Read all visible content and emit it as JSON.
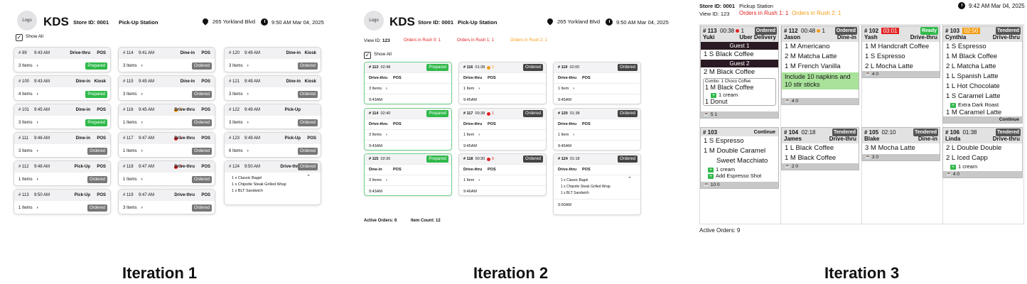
{
  "iter1": {
    "logo": "Logo",
    "app": "KDS",
    "store": "Store ID: 0001",
    "station": "Pick-Up Station",
    "address": "265 Yorkland Blvd",
    "datetime": "9:50 AM Mar 04, 2025",
    "show_all": "Show All",
    "cards": [
      {
        "num": "# 99",
        "time": "9:43 AM",
        "type": "Drive-thru",
        "src": "POS",
        "items": "3 Items",
        "status": "Prepared"
      },
      {
        "num": "# 100",
        "time": "9:43 AM",
        "type": "Dine-in",
        "src": "Kiosk",
        "items": "4 Items",
        "status": "Prepared"
      },
      {
        "num": "# 101",
        "time": "9:45 AM",
        "type": "Dine-in",
        "src": "POS",
        "items": "3 Items",
        "status": "Prepared"
      },
      {
        "num": "# 111",
        "time": "9:46 AM",
        "type": "Dine-in",
        "src": "POS",
        "items": "3 Items",
        "status": "Ordered"
      },
      {
        "num": "# 112",
        "time": "9:48 AM",
        "type": "Pick-Up",
        "src": "POS",
        "items": "1 Items",
        "status": "Ordered"
      },
      {
        "num": "# 113",
        "time": "9:50 AM",
        "type": "Pick-Up",
        "src": "POS",
        "items": "1 Items",
        "status": "Ordered"
      },
      {
        "num": "# 114",
        "time": "9:41 AM",
        "type": "Dine-in",
        "src": "POS",
        "items": "3 Items",
        "status": "Ordered"
      },
      {
        "num": "# 115",
        "time": "9:45 AM",
        "type": "Dine-in",
        "src": "POS",
        "items": "3 Items",
        "status": "Ordered"
      },
      {
        "num": "# 116",
        "time": "9:45 AM",
        "dot": "2",
        "type": "Drive-thru",
        "src": "POS",
        "items": "1 Items",
        "status": "Ordered"
      },
      {
        "num": "# 117",
        "time": "9:47 AM",
        "dot": "1",
        "type": "Drive-thru",
        "src": "POS",
        "items": "1 Items",
        "status": "Ordered"
      },
      {
        "num": "# 118",
        "time": "9:47 AM",
        "dot": "0",
        "type": "Drive-thru",
        "src": "POS",
        "items": "1 Items",
        "status": "Ordered"
      },
      {
        "num": "# 119",
        "time": "9:47 AM",
        "type": "Drive-thru",
        "src": "POS",
        "items": "3 Items",
        "status": "Ordered"
      },
      {
        "num": "# 120",
        "time": "9:49 AM",
        "type": "Dine-in",
        "src": "Kiosk",
        "items": "3 Items",
        "status": "Ordered"
      },
      {
        "num": "# 121",
        "time": "9:49 AM",
        "type": "Dine-in",
        "src": "Kiosk",
        "items": "3 Items",
        "status": "Ordered"
      },
      {
        "num": "# 122",
        "time": "9:49 AM",
        "type": "Pick-Up",
        "src": "",
        "items": "3 Items",
        "status": "Ordered"
      },
      {
        "num": "# 123",
        "time": "9:49 AM",
        "type": "Pick-Up",
        "src": "POS",
        "items": "6 Items",
        "status": "Ordered"
      }
    ],
    "expanded": {
      "num": "# 124",
      "time": "9:50 AM",
      "type": "Drive-thru",
      "src": "POS",
      "status": "Ordered",
      "lines": [
        "1 x  Classic Bagel",
        "1 x  Chipotle Steak Grilled Wrap",
        "1 x  BLT Sandwich"
      ]
    }
  },
  "iter2": {
    "logo": "Logo",
    "app": "KDS",
    "store": "Store ID: 0001",
    "station": "Pick-Up Station",
    "address": "265 Yorkland Blvd",
    "datetime": "9:50 AM Mar 04, 2025",
    "view_label": "View ID:",
    "view_id": "123",
    "rush0": "Orders in Rush 0: 1",
    "rush1": "Orders in Rush 1: 1",
    "rush2": "Orders in Rush 2: 1",
    "show_all": "Show All",
    "cards": [
      {
        "num": "# 113",
        "timer": "02:48",
        "type": "Drive-thru",
        "src": "POS",
        "items": "3 Items",
        "time": "9:43AM",
        "status": "Prepared"
      },
      {
        "num": "# 114",
        "timer": "02:40",
        "type": "Drive-thru",
        "src": "POS",
        "items": "3 Items",
        "time": "9:43AM",
        "status": "Prepared"
      },
      {
        "num": "# 115",
        "timer": "02:30",
        "type": "Dine-in",
        "src": "POS",
        "items": "3 Items",
        "time": "9:43AM",
        "status": "Prepared"
      },
      {
        "num": "# 116",
        "timer": "01:38",
        "dot": "2",
        "type": "Drive-thru",
        "src": "POS",
        "items": "1 Item",
        "time": "9:45AM",
        "status": "Ordered"
      },
      {
        "num": "# 117",
        "timer": "00:38",
        "dot": "1",
        "type": "Drive-thru",
        "src": "POS",
        "items": "1 Item",
        "time": "9:45AM",
        "status": "Ordered"
      },
      {
        "num": "# 118",
        "timer": "00:30",
        "dot": "0",
        "type": "Drive-thru",
        "src": "POS",
        "items": "1 Item",
        "time": "9:46AM",
        "status": "Ordered"
      },
      {
        "num": "# 119",
        "timer": "02:00",
        "type": "Drive-thru",
        "src": "POS",
        "items": "1 Item",
        "time": "9:45AM",
        "status": "Ordered"
      },
      {
        "num": "# 120",
        "timer": "01:38",
        "type": "Drive-thru",
        "src": "POS",
        "items": "1 Item",
        "time": "9:45AM",
        "status": "Ordered"
      }
    ],
    "expanded": {
      "num": "# 124",
      "timer": "01:18",
      "type": "Drive-thru",
      "src": "POS",
      "status": "Ordered",
      "lines": [
        "1 x  Classic Bagel",
        "1 x  Chipotle Steak Grilled Wrap",
        "1 x  BLT Sandwich"
      ],
      "time": "9:50AM"
    },
    "active": "Active Orders: 6",
    "count": "Item Count: 12"
  },
  "iter3": {
    "store": "Store ID: 0001",
    "station": "Pickup Station",
    "view": "View ID: 123",
    "rush1": "Orders in Rush 1: 1",
    "rush2": "Orders in Rush 2: 1",
    "datetime": "9:42 AM Mar 04, 2025",
    "active": "Active Orders: 9",
    "c113": {
      "num": "# 113",
      "timer": "00:38",
      "dot": "1",
      "status": "Ordered",
      "name": "Yuki",
      "type": "Uber Delivery",
      "guest1": "Guest 1",
      "item1": "1 S Black Coffee",
      "guest2": "Guest 2",
      "item2": "2 M Black Coffee",
      "combo": "Combo: 1 Choco Coffee",
      "combo1": "1 M Black Coffee",
      "mod": "1 cream",
      "combo2": "1 Donut",
      "foot": "5   1"
    },
    "c112": {
      "num": "# 112",
      "timer": "00:48",
      "dot": "1",
      "status": "Ordered",
      "name": "Jason",
      "type": "Dine-in",
      "i1": "1 M Americano",
      "i2": "2 M Matcha Latte",
      "i3": "1 M French Vanilla",
      "note": "Include 10 napkins and 10 stir sticks",
      "foot": "4   0"
    },
    "c102": {
      "num": "# 102",
      "timer": "03:01",
      "status": "Ready",
      "name": "Yash",
      "type": "Drive-thru",
      "i1": "1 M Handcraft Coffee",
      "i2": "1 S Espresso",
      "i3": "2 L Mocha Latte",
      "foot": "4   0"
    },
    "c103a": {
      "num": "# 103",
      "timer": "02:50",
      "status": "Tendered",
      "name": "Cynthia",
      "type": "Drive-thru",
      "i1": "1 S Espresso",
      "i2": "1 M Black Coffee",
      "i3": "2 L Matcha Latte",
      "i4": "1 L Spanish Latte",
      "i5": "1 L Hot Chocolate",
      "i6": "1 S Caramel Latte",
      "mod": "Extra Dark Roast",
      "i7": "1 M Caramel Latte",
      "cont": "Continue"
    },
    "c103b": {
      "num": "# 103",
      "status": "Continue",
      "i1": "1 S Espresso",
      "i2": "1 M Double Caramel",
      "i2b": "Sweet Macchiato",
      "mod1": "1 cream",
      "mod2": "Add Espresso Shot",
      "foot": "10   0"
    },
    "c104": {
      "num": "# 104",
      "timer": "02:18",
      "status": "Tendered",
      "name": "James",
      "type": "Drive-thru",
      "i1": "1 L Black Coffee",
      "i2": "1 M Black Coffee",
      "foot": "2   0"
    },
    "c105": {
      "num": "# 105",
      "timer": "02:10",
      "status": "Tendered",
      "name": "Blake",
      "type": "Dine-in",
      "i1": "3 M Mocha Latte",
      "foot": "3   0"
    },
    "c106": {
      "num": "# 106",
      "timer": "01:38",
      "status": "Tendered",
      "name": "Linda",
      "type": "Drive-thru",
      "i1": "2 L Double Double",
      "i2": "2 L Iced Capp",
      "mod": "1 cream",
      "foot": "4   0"
    }
  },
  "labels": {
    "i1": "Iteration 1",
    "i2": "Iteration 2",
    "i3": "Iteration 3"
  },
  "colors": {
    "green": "#2fb94a",
    "red": "#e02020",
    "orange": "#f39c12",
    "guest": "#2b1a23",
    "note": "#a9e29a"
  }
}
